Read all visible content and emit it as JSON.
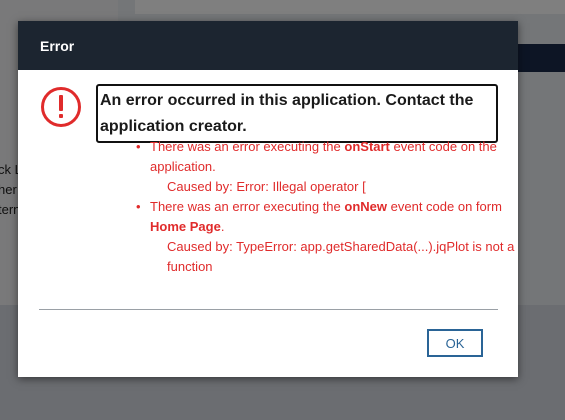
{
  "background": {
    "side_text_lines": [
      "ck L",
      "her",
      "tern"
    ]
  },
  "dialog": {
    "title": "Error",
    "icon": "exclamation-circle-icon",
    "message": "An error occurred in this application. Contact the application creator.",
    "errors": [
      {
        "text_before": "There was an error executing the ",
        "event": "onStart",
        "text_after": " event code on the application.",
        "form": "",
        "caused_by": "Caused by: Error: Illegal operator ["
      },
      {
        "text_before": "There was an error executing the ",
        "event": "onNew",
        "text_after": " event code on form ",
        "form": "Home Page",
        "form_suffix": ".",
        "caused_by": "Caused by: TypeError: app.getSharedData(...).jqPlot is not a function"
      }
    ],
    "ok_label": "OK"
  },
  "colors": {
    "header_bg": "#1c2530",
    "error_red": "#e02b2b",
    "button_blue": "#2a6496"
  }
}
